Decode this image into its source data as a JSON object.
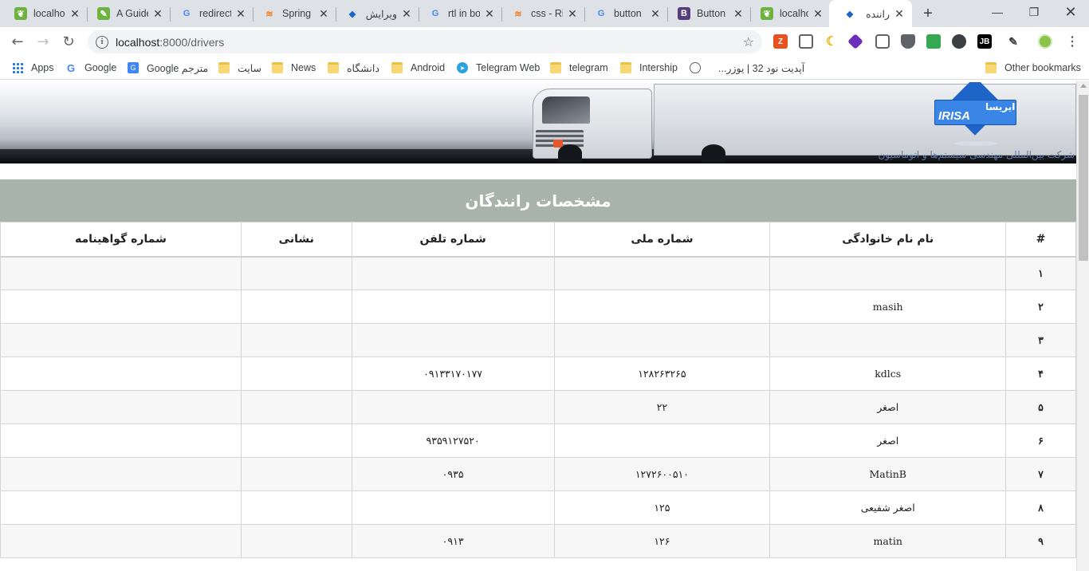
{
  "browser": {
    "tabs": [
      {
        "title": "localhost",
        "icon": "spring-leaf-icon",
        "color": "#6db33f"
      },
      {
        "title": "A Guide",
        "icon": "spring-guide-icon",
        "color": "#6db33f"
      },
      {
        "title": "redirect",
        "icon": "google-icon",
        "color": "#4285f4"
      },
      {
        "title": "Spring",
        "icon": "stackoverflow-icon",
        "color": "#f48024"
      },
      {
        "title": "ویرایش",
        "icon": "irisa-favicon-icon",
        "color": "#1e64c8"
      },
      {
        "title": "rtl in bo",
        "icon": "google-icon",
        "color": "#4285f4"
      },
      {
        "title": "css - Ri",
        "icon": "stackoverflow-icon",
        "color": "#f48024"
      },
      {
        "title": "button",
        "icon": "google-icon",
        "color": "#4285f4"
      },
      {
        "title": "Button",
        "icon": "bootstrap-icon",
        "color": "#563d7c"
      },
      {
        "title": "localhost",
        "icon": "spring-leaf-icon",
        "color": "#6db33f"
      },
      {
        "title": "راننده ها",
        "icon": "irisa-favicon-icon",
        "color": "#1e64c8"
      }
    ],
    "address": {
      "host": "localhost",
      "path": ":8000/drivers"
    },
    "bookmarks": [
      {
        "label": "Apps",
        "icon": "apps-grid-icon"
      },
      {
        "label": "Google",
        "icon": "google-icon"
      },
      {
        "label": "Google مترجم",
        "icon": "google-translate-icon"
      },
      {
        "label": "سایت",
        "icon": "folder-icon"
      },
      {
        "label": "News",
        "icon": "folder-icon"
      },
      {
        "label": "دانشگاه",
        "icon": "folder-icon"
      },
      {
        "label": "Android",
        "icon": "folder-icon"
      },
      {
        "label": "Telegram Web",
        "icon": "telegram-icon"
      },
      {
        "label": "telegram",
        "icon": "folder-icon"
      },
      {
        "label": "Intership",
        "icon": "folder-icon"
      },
      {
        "label": "آپدیت نود 32 | یوزر...",
        "icon": "globe-icon"
      }
    ],
    "other_bookmarks": "Other bookmarks"
  },
  "banner": {
    "logo_latin": "IRISA",
    "logo_persian": "ایریسا",
    "tagline": "شرکت بین‌المللی مهندسی سیستم‌ها و اتوماسیون"
  },
  "page": {
    "heading": "مشخصات رانندگان",
    "columns": [
      "#",
      "نام نام خانوادگی",
      "شماره ملی",
      "شماره تلفن",
      "نشانی",
      "شماره گواهینامه"
    ],
    "rows": [
      [
        "۱",
        "",
        "",
        "",
        "",
        ""
      ],
      [
        "۲",
        "masih",
        "",
        "",
        "",
        ""
      ],
      [
        "۳",
        "",
        "",
        "",
        "",
        ""
      ],
      [
        "۴",
        "kdlcs",
        "۱۲۸۲۶۳۲۶۵",
        "۰۹۱۳۳۱۷۰۱۷۷",
        "",
        ""
      ],
      [
        "۵",
        "اصغر",
        "۲۲",
        "",
        "",
        ""
      ],
      [
        "۶",
        "اصغر",
        "",
        "۹۳۵۹۱۲۷۵۲۰",
        "",
        ""
      ],
      [
        "۷",
        "MatinB",
        "۱۲۷۲۶۰۰۵۱۰",
        "۰۹۳۵",
        "",
        ""
      ],
      [
        "۸",
        "اصغر شفیعی",
        "۱۲۵",
        "",
        "",
        ""
      ],
      [
        "۹",
        "matin",
        "۱۲۶",
        "۰۹۱۳",
        "",
        ""
      ]
    ]
  }
}
